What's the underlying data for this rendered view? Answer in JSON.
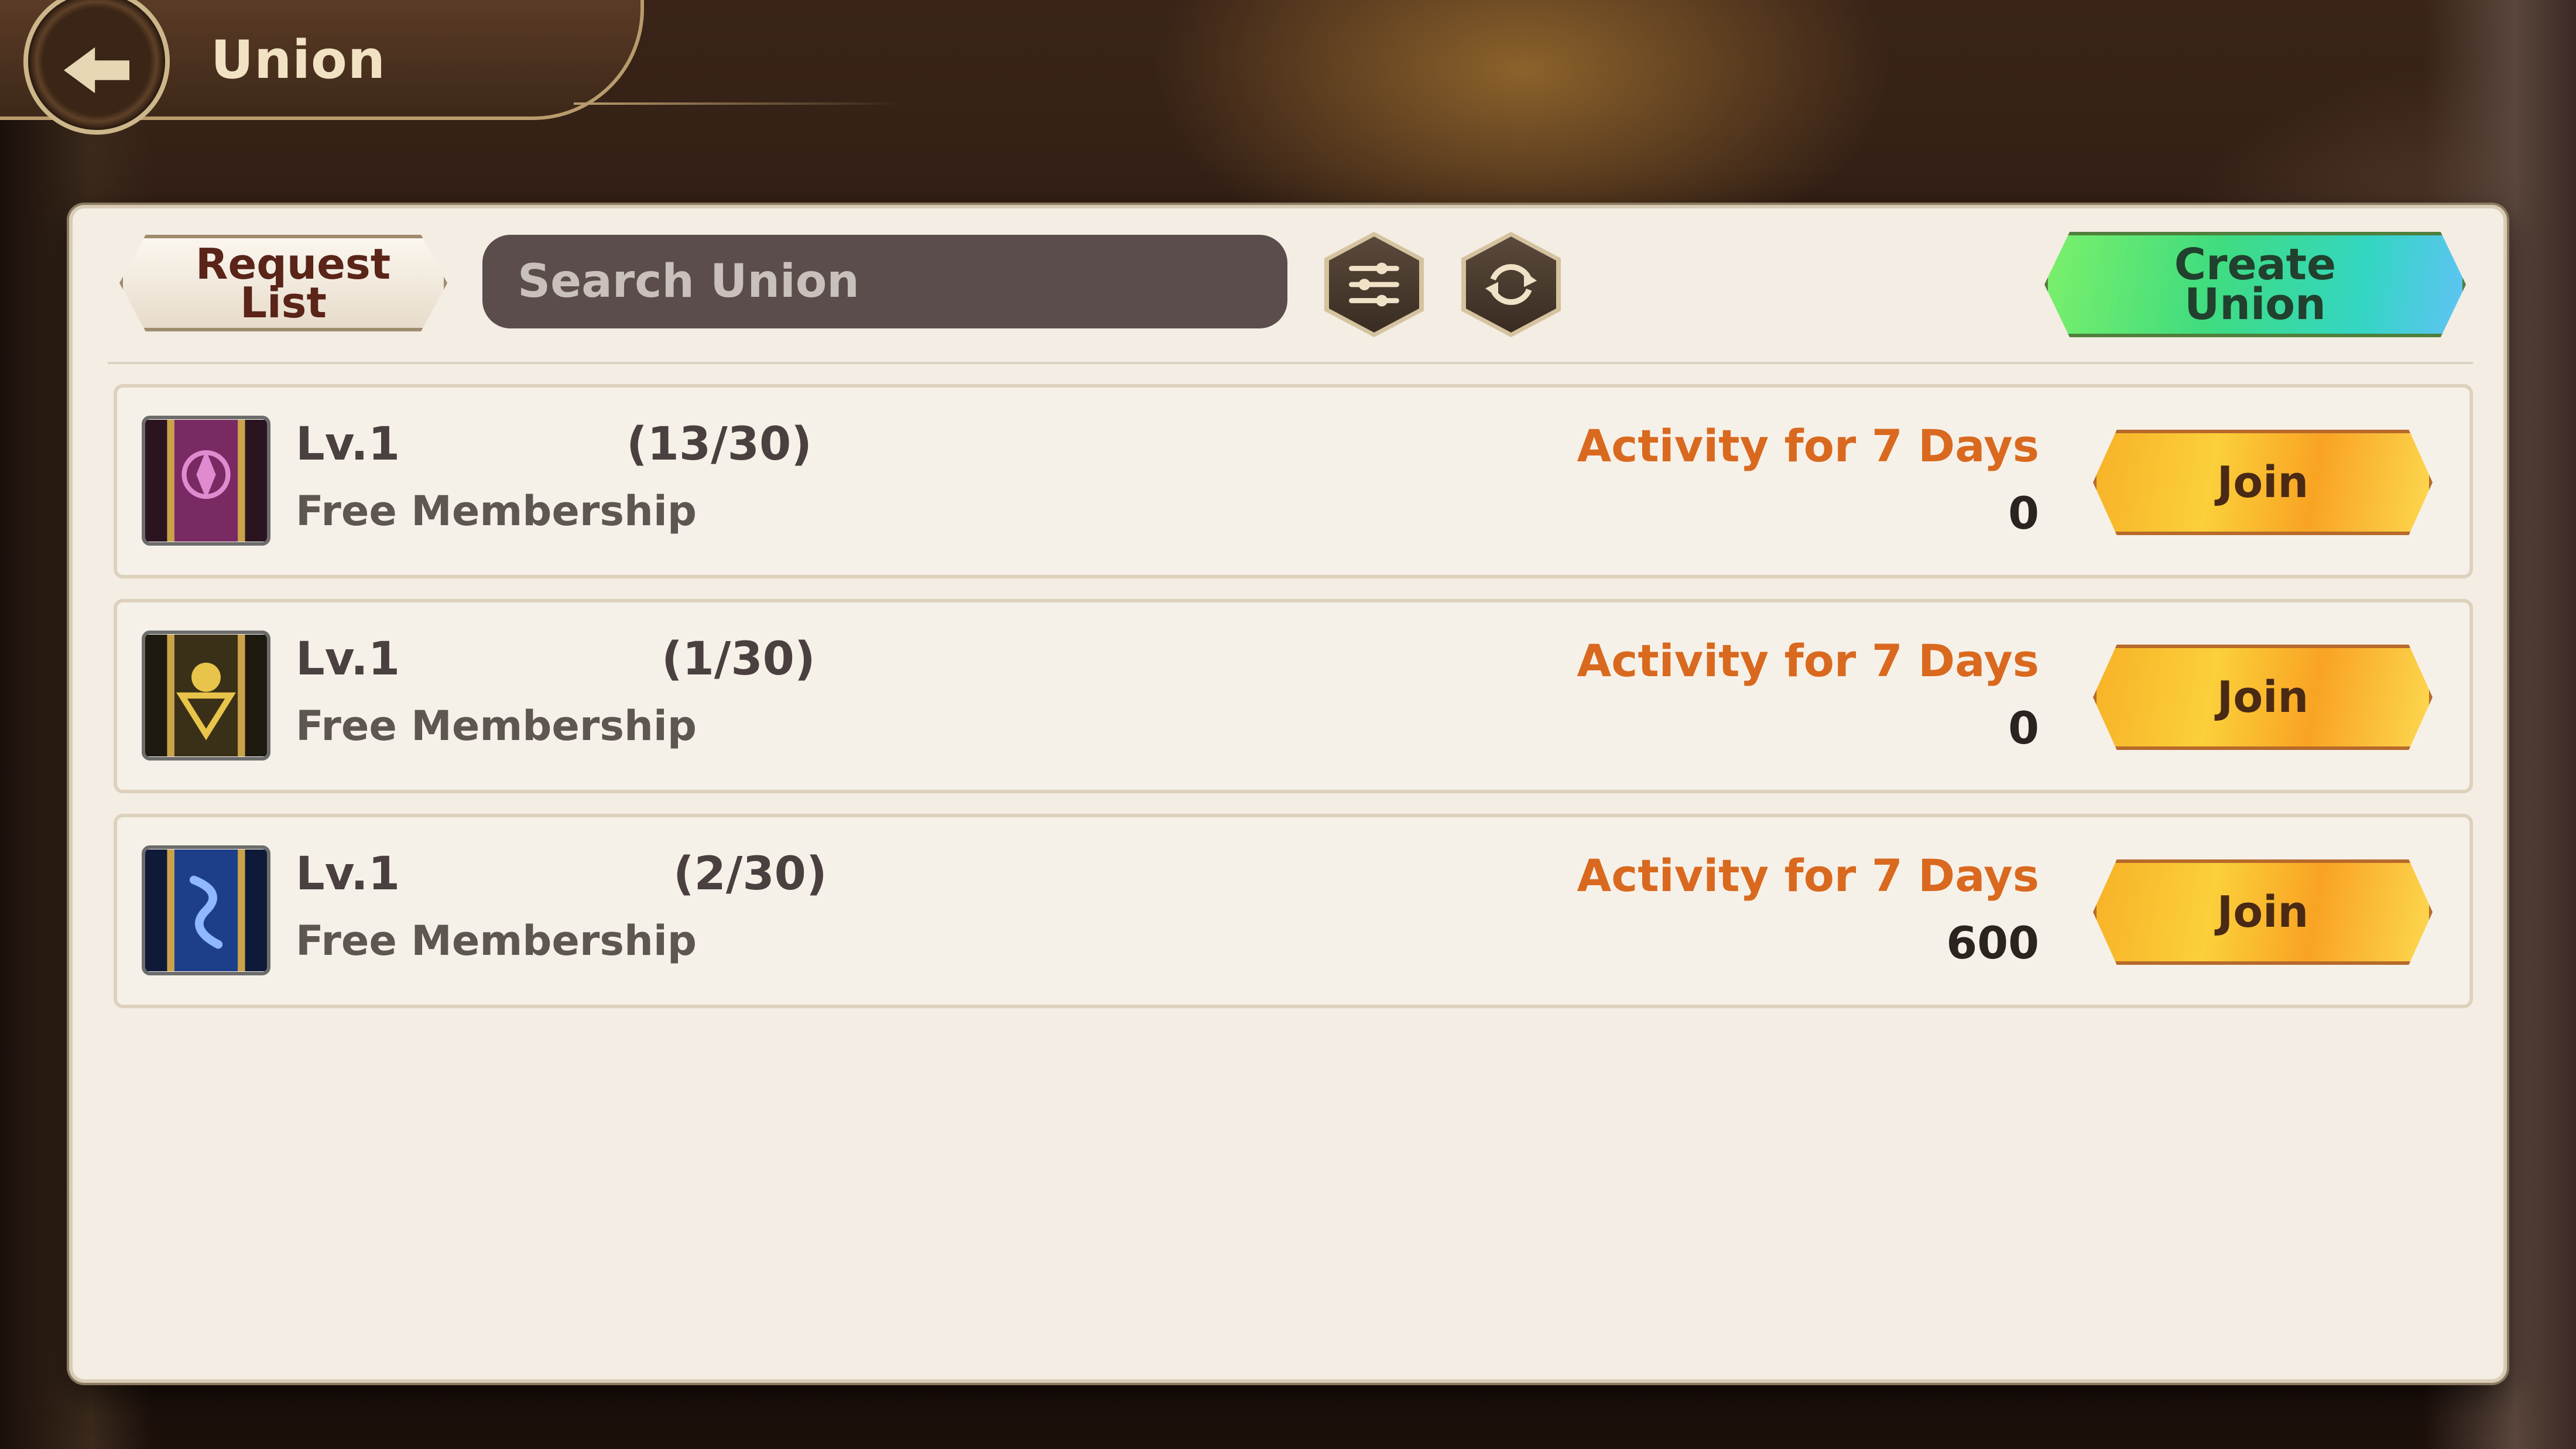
{
  "header": {
    "title": "Union"
  },
  "toolbar": {
    "request_list_label": "Request List",
    "search": {
      "placeholder": "Search Union",
      "value": ""
    },
    "create_union_label": "Create Union"
  },
  "unions": [
    {
      "level": "Lv.1",
      "members": "(13/30)",
      "membership": "Free Membership",
      "activity_label": "Activity for 7 Days",
      "activity_value": "0",
      "join_label": "Join",
      "emblem_color": "#7a2a63"
    },
    {
      "level": "Lv.1",
      "members": "(1/30)",
      "membership": "Free Membership",
      "activity_label": "Activity for 7 Days",
      "activity_value": "0",
      "join_label": "Join",
      "emblem_color": "#7b6320"
    },
    {
      "level": "Lv.1",
      "members": "(2/30)",
      "membership": "Free Membership",
      "activity_label": "Activity for 7 Days",
      "activity_value": "600",
      "join_label": "Join",
      "emblem_color": "#1d3f8a"
    }
  ],
  "icons": {
    "back": "arrow-left-icon",
    "filter": "sliders-icon",
    "refresh": "refresh-icon"
  },
  "colors": {
    "activity": "#d9691f",
    "join": "#fbd03a",
    "create": "#3fdc7f"
  }
}
